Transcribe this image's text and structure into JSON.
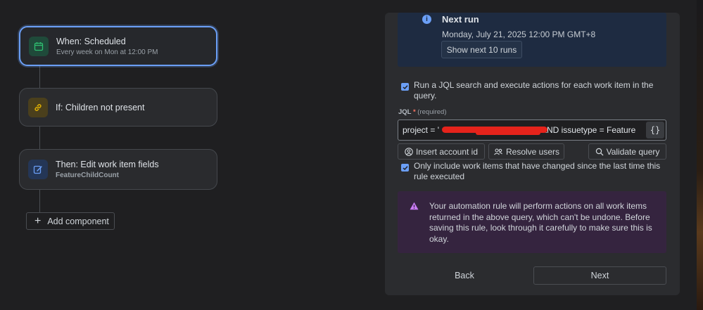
{
  "flow": {
    "nodes": [
      {
        "title": "When: Scheduled",
        "subtitle": "Every week on Mon at 12:00 PM",
        "icon": "calendar-icon",
        "color": "#2fbf71"
      },
      {
        "title": "If: Children not present",
        "subtitle": "",
        "icon": "link-icon",
        "color": "#e2b203"
      },
      {
        "title": "Then: Edit work item fields",
        "subtitle": "FeatureChildCount",
        "icon": "edit-icon",
        "color": "#6b9ff6"
      }
    ],
    "add_component_label": "Add component"
  },
  "panel": {
    "next_run": {
      "title": "Next run",
      "date": "Monday, July 21, 2025 12:00 PM GMT+8",
      "show_next_label": "Show next 10 runs"
    },
    "jql_search": {
      "checked": true,
      "label": "Run a JQL search and execute actions for each work item in the query."
    },
    "jql": {
      "label": "JQL",
      "required_marker": "*",
      "required_text": "(required)",
      "value_prefix": "project = '",
      "value_suffix": "' AND issuetype = Feature",
      "braces_label": "{}"
    },
    "buttons": {
      "insert_account": "Insert account id",
      "resolve_users": "Resolve users",
      "validate_query": "Validate query"
    },
    "changed_only": {
      "checked": true,
      "label": "Only include work items that have changed since the last time this rule executed"
    },
    "warning": "Your automation rule will perform actions on all work items returned in the above query, which can't be undone. Before saving this rule, look through it carefully to make sure this is okay.",
    "back_label": "Back",
    "next_label": "Next"
  },
  "colors": {
    "accent": "#6b9ff6",
    "warning": "#c97cf4",
    "redaction": "#e5231b"
  }
}
